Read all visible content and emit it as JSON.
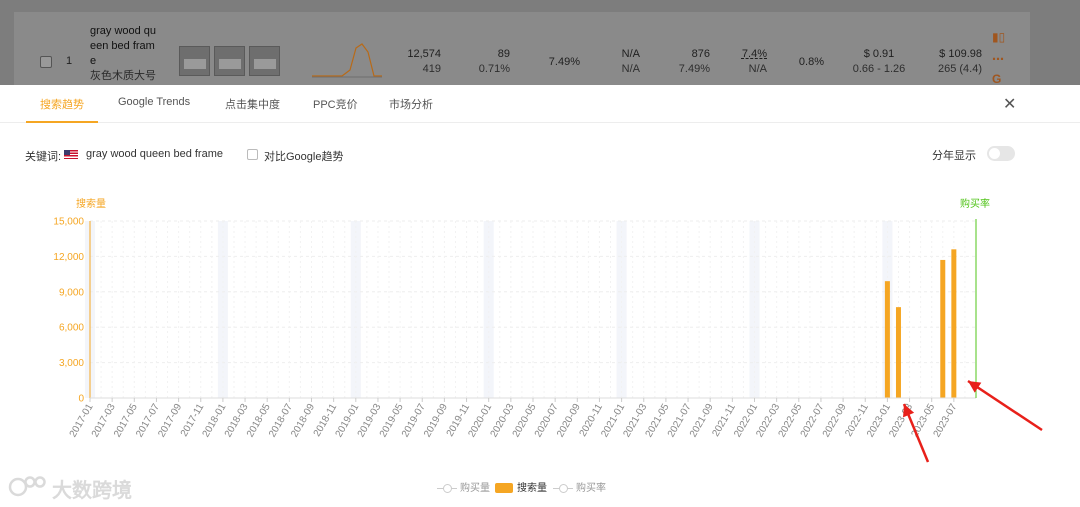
{
  "background_row": {
    "index": "1",
    "title_en": "gray wood queen bed frame",
    "title_cn": "灰色木质大号",
    "title_lines": [
      "gray wood qu",
      "een bed fram",
      "e"
    ],
    "search_volume": "12,574",
    "search_rank": "419",
    "clicks": "89",
    "click_rate": "0.71%",
    "conversion": "7.49%",
    "na_1": "N/A",
    "na_2": "N/A",
    "purchases": "876",
    "purchase_rate": "7.49%",
    "share": "7.4%",
    "share_sub": "N/A",
    "ratio": "0.8%",
    "ppc": "$ 0.91",
    "ppc_range": "0.66 - 1.26",
    "price": "$ 109.98",
    "reviews": "265 (4.4)"
  },
  "tabs": [
    {
      "label": "搜索趋势",
      "active": true
    },
    {
      "label": "Google Trends",
      "active": false
    },
    {
      "label": "点击集中度",
      "active": false
    },
    {
      "label": "PPC竞价",
      "active": false
    },
    {
      "label": "市场分析",
      "active": false
    }
  ],
  "keyword": {
    "label": "关键词:",
    "value": "gray wood queen bed frame",
    "compare_label": "对比Google趋势",
    "year_display_label": "分年显示"
  },
  "watermark": "大数跨境",
  "colors": {
    "accent": "#f5a623",
    "conversion_line": "#52c41a",
    "arrow": "#e8201a"
  },
  "chart_data": {
    "type": "bar",
    "left_axis_title": "搜索量",
    "right_axis_title": "购买率",
    "ylim": [
      0,
      15000
    ],
    "yticks": [
      "0",
      "3,000",
      "6,000",
      "9,000",
      "12,000",
      "15,000"
    ],
    "ytick_values": [
      0,
      3000,
      6000,
      9000,
      12000,
      15000
    ],
    "x_tick_labels": [
      "2017-01",
      "2017-03",
      "2017-05",
      "2017-07",
      "2017-09",
      "2017-11",
      "2018-01",
      "2018-03",
      "2018-05",
      "2018-07",
      "2018-09",
      "2018-11",
      "2019-01",
      "2019-03",
      "2019-05",
      "2019-07",
      "2019-09",
      "2019-11",
      "2020-01",
      "2020-03",
      "2020-05",
      "2020-07",
      "2020-09",
      "2020-11",
      "2021-01",
      "2021-03",
      "2021-05",
      "2021-07",
      "2021-09",
      "2021-11",
      "2022-01",
      "2022-03",
      "2022-05",
      "2022-07",
      "2022-09",
      "2022-11",
      "2023-01",
      "2023-03",
      "2023-05",
      "2023-07"
    ],
    "month_count": 80,
    "first_month": "2017-01",
    "highlighted_months": [
      "2017-01",
      "2018-01",
      "2019-01",
      "2020-01",
      "2021-01",
      "2022-01",
      "2023-01"
    ],
    "series": [
      {
        "name": "搜索量",
        "kind": "bar",
        "points": [
          {
            "month": "2023-01",
            "value": 9900
          },
          {
            "month": "2023-02",
            "value": 7700
          },
          {
            "month": "2023-06",
            "value": 11700
          },
          {
            "month": "2023-07",
            "value": 12600
          }
        ]
      }
    ],
    "legend": [
      {
        "name": "购买量",
        "style": "line"
      },
      {
        "name": "搜索量",
        "style": "bar"
      },
      {
        "name": "购买率",
        "style": "line"
      }
    ],
    "legend_position": "bottom-center",
    "grid": true
  }
}
